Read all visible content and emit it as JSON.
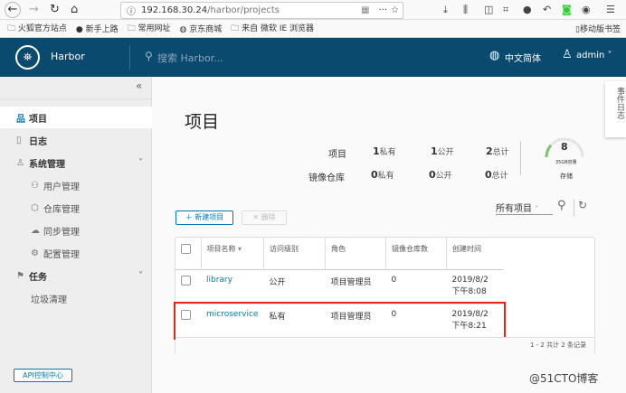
{
  "browser": {
    "url_host": "192.168.30.24",
    "url_path": "/harbor/projects",
    "bookmarks": [
      "火狐官方站点",
      "新手上路",
      "常用网址",
      "京东商城",
      "来自 微软 IE 浏览器"
    ],
    "mobile_bookmarks": "移动版书签"
  },
  "header": {
    "app_name": "Harbor",
    "search_placeholder": "搜索 Harbor...",
    "language": "中文简体",
    "user": "admin"
  },
  "sidebar": {
    "items": [
      {
        "label": "项目"
      },
      {
        "label": "日志"
      },
      {
        "label": "系统管理"
      },
      {
        "label": "用户管理"
      },
      {
        "label": "仓库管理"
      },
      {
        "label": "同步管理"
      },
      {
        "label": "配置管理"
      },
      {
        "label": "任务"
      },
      {
        "label": "垃圾清理"
      }
    ],
    "api_button": "API控制中心"
  },
  "main": {
    "title": "项目",
    "event_log_tab": "事件日志",
    "stats": {
      "projects_label": "项目",
      "repos_label": "镜像仓库",
      "projects": {
        "private": "1",
        "public": "1",
        "total": "2"
      },
      "repos": {
        "private": "0",
        "public": "0",
        "total": "0"
      },
      "private_label": "私有",
      "public_label": "公开",
      "total_label": "总计"
    },
    "storage": {
      "value": "8",
      "capacity": "35GB容量",
      "label": "存储",
      "used_fraction": 0.23
    },
    "new_button": "新建项目",
    "delete_button": "删除",
    "filter": "所有项目",
    "table": {
      "headers": [
        "项目名称",
        "访问级别",
        "角色",
        "镜像仓库数",
        "创建时间"
      ],
      "rows": [
        {
          "name": "library",
          "access": "公开",
          "role": "项目管理员",
          "repos": "0",
          "date": "2019/8/2",
          "time": "下午8:08"
        },
        {
          "name": "microservice",
          "access": "私有",
          "role": "项目管理员",
          "repos": "0",
          "date": "2019/8/2",
          "time": "下午8:21"
        }
      ],
      "footer": "1 - 2 共计 2 条记录"
    }
  },
  "watermark": "@51CTO博客"
}
